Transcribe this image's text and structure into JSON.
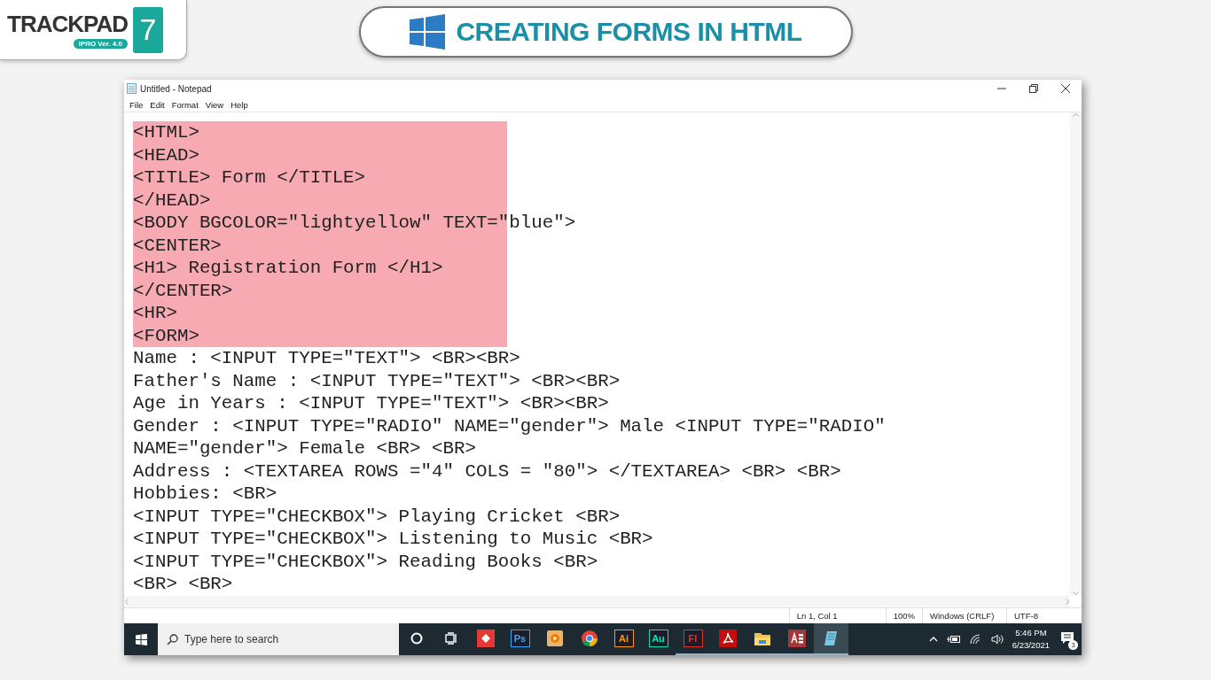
{
  "logo": {
    "name": "TRACKPAD",
    "number": "7",
    "badge": "IPRO Ver. 4.0"
  },
  "banner": {
    "title": "CREATING FORMS IN HTML"
  },
  "window": {
    "title": "Untitled - Notepad",
    "menu": [
      "File",
      "Edit",
      "Format",
      "View",
      "Help"
    ],
    "lines": [
      {
        "text": "<HTML>",
        "highlighted": true
      },
      {
        "text": "<HEAD>",
        "highlighted": true
      },
      {
        "text": "<TITLE> Form </TITLE>",
        "highlighted": true
      },
      {
        "text": "</HEAD>",
        "highlighted": true
      },
      {
        "text": "<BODY BGCOLOR=\"lightyellow\" TEXT=\"blue\">",
        "highlighted": true
      },
      {
        "text": "<CENTER>",
        "highlighted": true
      },
      {
        "text": "<H1> Registration Form </H1>",
        "highlighted": true
      },
      {
        "text": "</CENTER>",
        "highlighted": true
      },
      {
        "text": "<HR>",
        "highlighted": true
      },
      {
        "text": "<FORM>",
        "highlighted": true
      },
      {
        "text": "Name : <INPUT TYPE=\"TEXT\"> <BR><BR>",
        "highlighted": false
      },
      {
        "text": "Father's Name : <INPUT TYPE=\"TEXT\"> <BR><BR>",
        "highlighted": false
      },
      {
        "text": "Age in Years : <INPUT TYPE=\"TEXT\"> <BR><BR>",
        "highlighted": false
      },
      {
        "text": "Gender : <INPUT TYPE=\"RADIO\" NAME=\"gender\"> Male <INPUT TYPE=\"RADIO\"",
        "highlighted": false
      },
      {
        "text": "NAME=\"gender\"> Female <BR> <BR>",
        "highlighted": false
      },
      {
        "text": "Address : <TEXTAREA ROWS =\"4\" COLS = \"80\"> </TEXTAREA> <BR> <BR>",
        "highlighted": false
      },
      {
        "text": "Hobbies: <BR>",
        "highlighted": false
      },
      {
        "text": "<INPUT TYPE=\"CHECKBOX\"> Playing Cricket <BR>",
        "highlighted": false
      },
      {
        "text": "<INPUT TYPE=\"CHECKBOX\"> Listening to Music <BR>",
        "highlighted": false
      },
      {
        "text": "<INPUT TYPE=\"CHECKBOX\"> Reading Books <BR>",
        "highlighted": false
      },
      {
        "text": "<BR> <BR>",
        "highlighted": false
      }
    ],
    "status_bar": [
      "Ln 1, Col 1",
      "100%",
      "Windows (CRLF)",
      "UTF-8"
    ]
  },
  "taskbar": {
    "search": {
      "placeholder": "Type here to search"
    },
    "apps": [
      {
        "kind": "cortana",
        "running": false,
        "active": false
      },
      {
        "kind": "taskview",
        "running": false,
        "active": false
      },
      {
        "kind": "remote",
        "running": false,
        "active": false
      },
      {
        "kind": "badge",
        "label": "Ps",
        "color": "#31a8ff",
        "running": false,
        "active": false
      },
      {
        "kind": "player",
        "running": false,
        "active": false
      },
      {
        "kind": "chrome",
        "running": false,
        "active": false
      },
      {
        "kind": "badge",
        "label": "Ai",
        "color": "#ff9a00",
        "running": false,
        "active": false
      },
      {
        "kind": "badge",
        "label": "Au",
        "color": "#00e4bb",
        "running": false,
        "active": false
      },
      {
        "kind": "badge",
        "label": "Fl",
        "color": "#e0342a",
        "running": true,
        "active": false
      },
      {
        "kind": "pdf",
        "running": true,
        "active": false
      },
      {
        "kind": "folder",
        "running": true,
        "active": false
      },
      {
        "kind": "access",
        "running": true,
        "active": false
      },
      {
        "kind": "notepad",
        "running": true,
        "active": true
      }
    ],
    "time": "5:46 PM",
    "date": "6/23/2021",
    "notifications": "3"
  }
}
